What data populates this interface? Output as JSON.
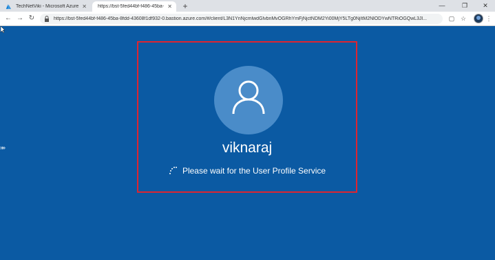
{
  "browser": {
    "tabs": [
      {
        "title": "TechNetViki - Microsoft Azure",
        "active": false,
        "favicon": "azure-icon"
      },
      {
        "title": "https://bst-5fed44bf-f486-45ba-",
        "active": true,
        "favicon": "page-icon"
      }
    ],
    "url": "https://bst-5fed44bf-f486-45ba-8fdd-43608f1df932-0.bastion.azure.com/#/client/L3N1YnNjcmlwdGlvbnMvOGRhYmFjNjctNDM2Yi00MjY5LTg0NjItM2NlODYwNTRiOGQwL3Jl..."
  },
  "login_screen": {
    "username": "viknaraj",
    "status": "Please wait for the User Profile Service",
    "background_color": "#0b5aa3",
    "highlight_color": "#e0242f"
  }
}
